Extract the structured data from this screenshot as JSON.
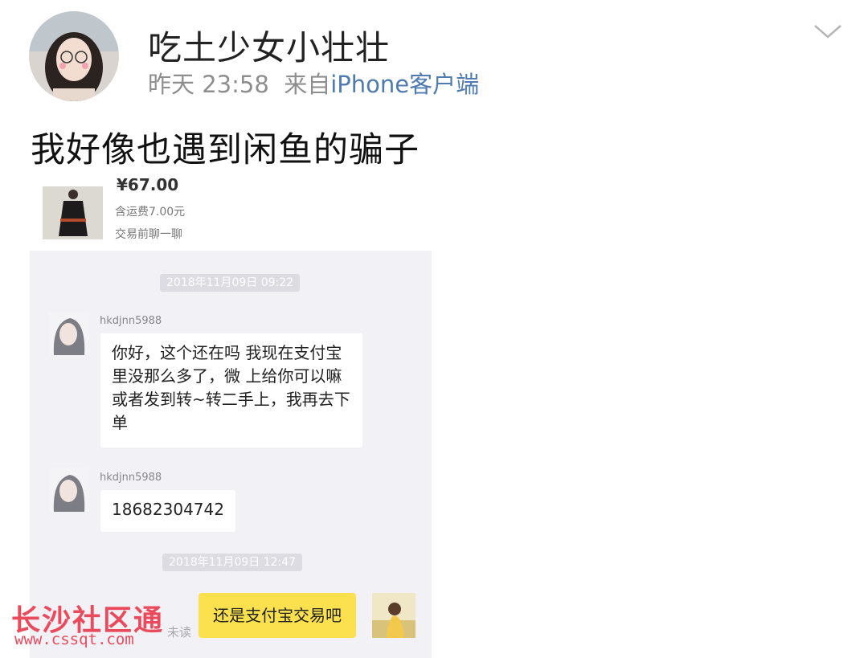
{
  "post": {
    "author": "吃土少女小壮壮",
    "time": "昨天 23:58",
    "source_prefix": "来自",
    "source_client": "iPhone客户端",
    "text": "我好像也遇到闲鱼的骗子"
  },
  "screenshot": {
    "product": {
      "price": "¥67.00",
      "shipping": "含运费7.00元",
      "chat_prompt": "交易前聊一聊"
    },
    "timestamps": [
      "2018年11月09日 09:22",
      "2018年11月09日 12:47"
    ],
    "messages": [
      {
        "sender": "hkdjnn5988",
        "text": "你好，这个还在吗 我现在支付宝里没那么多了，微 上给你可以嘛 或者发到转~转二手上，我再去下单"
      },
      {
        "sender": "hkdjnn5988",
        "text": "18682304742"
      },
      {
        "sender": "me",
        "text": "还是支付宝交易吧",
        "status": "未读"
      }
    ]
  },
  "watermark": {
    "title": "长沙社区通",
    "url": "www.cssqt.com"
  },
  "colors": {
    "meta_gray": "#8e8e8e",
    "client_link": "#4f7bb0",
    "chat_bg": "#f1f1f6",
    "my_bubble": "#fbe14e",
    "watermark": "#e94b5c"
  },
  "icons": [
    "chevron-down-icon"
  ]
}
